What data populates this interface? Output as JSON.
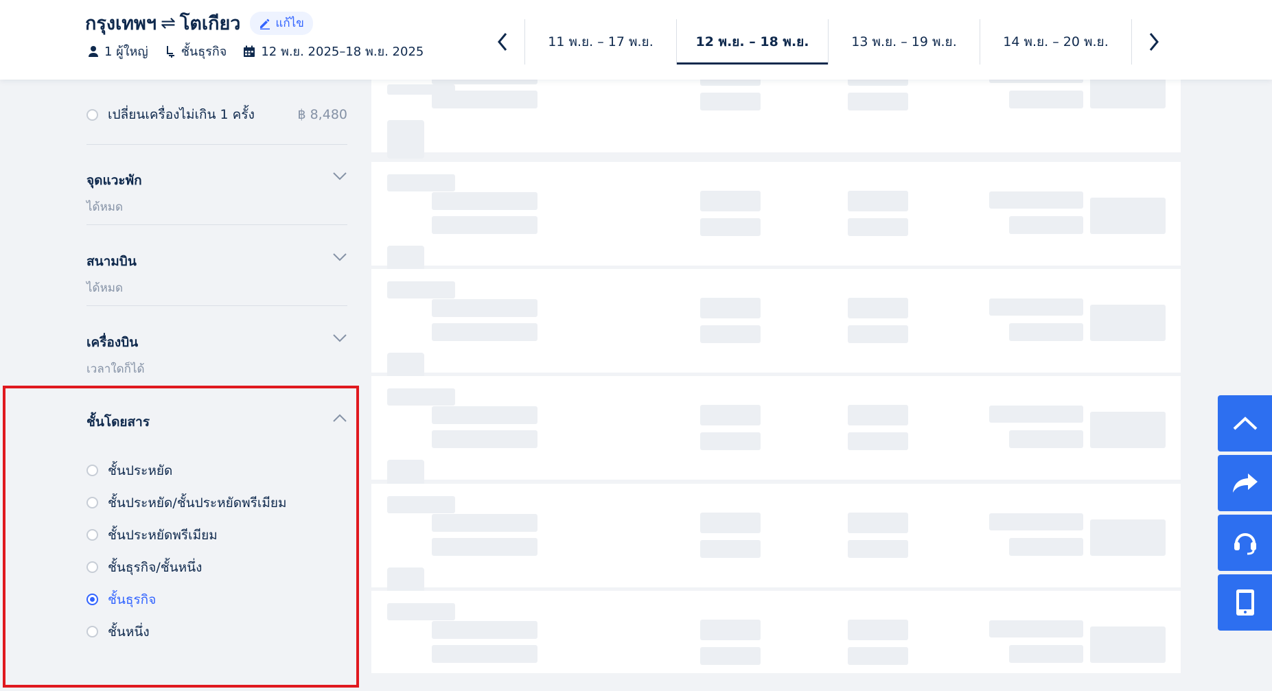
{
  "header": {
    "origin": "กรุงเทพฯ",
    "swap_symbol": "⇌",
    "destination": "โตเกียว",
    "edit_label": "แก้ไข",
    "passengers": "1 ผู้ใหญ่",
    "cabin": "ชั้นธุรกิจ",
    "dates": "12 พ.ย. 2025–18 พ.ย. 2025"
  },
  "date_tabs": [
    {
      "label": "11 พ.ย. – 17 พ.ย.",
      "active": false
    },
    {
      "label": "12 พ.ย. – 18 พ.ย.",
      "active": true
    },
    {
      "label": "13 พ.ย. – 19 พ.ย.",
      "active": false
    },
    {
      "label": "14 พ.ย. – 20 พ.ย.",
      "active": false
    }
  ],
  "filters": {
    "stops_option": {
      "label": "เปลี่ยนเครื่องไม่เกิน 1 ครั้ง",
      "price": "฿ 8,480"
    },
    "sections": [
      {
        "title": "จุดแวะพัก",
        "value": "ได้หมด"
      },
      {
        "title": "สนามบิน",
        "value": "ได้หมด"
      },
      {
        "title": "เครื่องบิน",
        "value": "เวลาใดก็ได้"
      }
    ],
    "cabin_class": {
      "title": "ชั้นโดยสาร",
      "options": [
        {
          "label": "ชั้นประหยัด",
          "checked": false
        },
        {
          "label": "ชั้นประหยัด/ชั้นประหยัดพรีเมียม",
          "checked": false
        },
        {
          "label": "ชั้นประหยัดพรีเมียม",
          "checked": false
        },
        {
          "label": "ชั้นธุรกิจ/ชั้นหนึ่ง",
          "checked": false
        },
        {
          "label": "ชั้นธุรกิจ",
          "checked": true
        },
        {
          "label": "ชั้นหนึ่ง",
          "checked": false
        }
      ]
    }
  },
  "colors": {
    "accent": "#3264ff",
    "fab": "#2d6ff0",
    "highlight": "#e0191f",
    "text": "#0f294d"
  },
  "floating_buttons": [
    "back-to-top-icon",
    "share-icon",
    "support-headset-icon",
    "mobile-app-icon"
  ]
}
